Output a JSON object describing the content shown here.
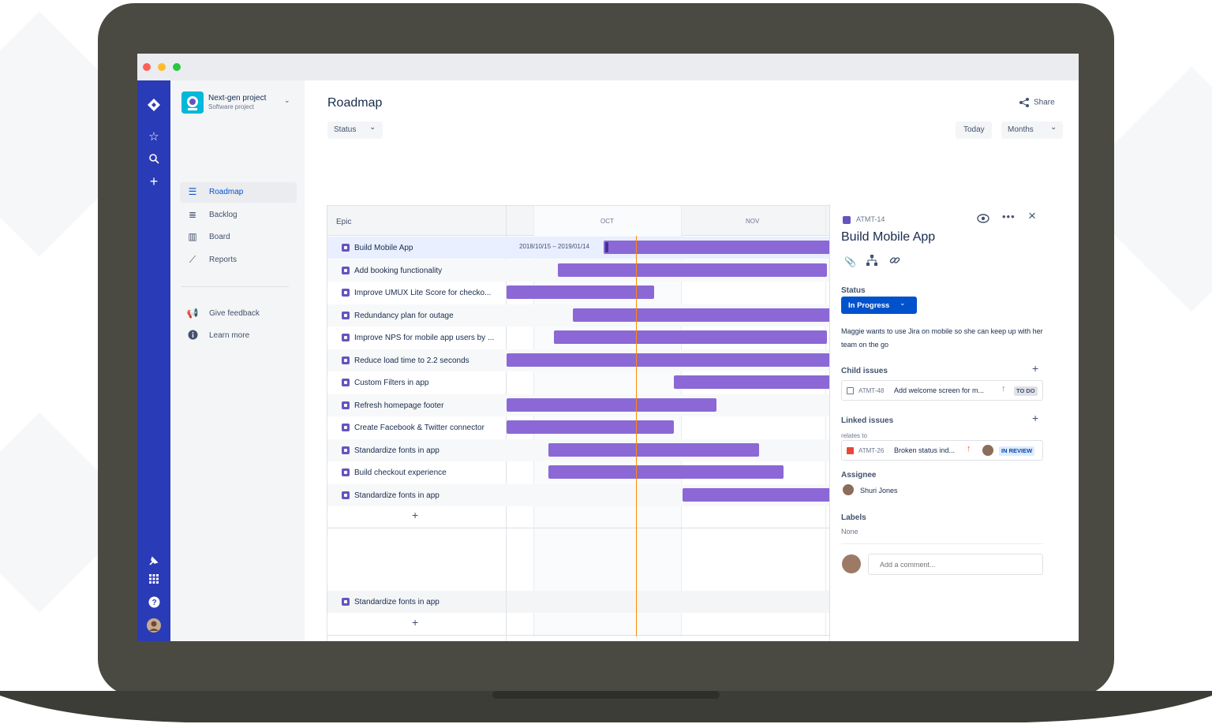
{
  "window": {
    "traffic_lights": [
      "#ff5f57",
      "#febc2e",
      "#28c840"
    ]
  },
  "global_nav": {
    "icons": [
      "jira-logo-icon",
      "star-icon",
      "search-icon",
      "plus-icon",
      "notification-icon",
      "app-switcher-icon",
      "help-icon",
      "user-avatar"
    ]
  },
  "project": {
    "name": "Next-gen project",
    "type": "Software project"
  },
  "sidebar": {
    "items": [
      {
        "label": "Roadmap",
        "icon": "roadmap-icon",
        "active": true
      },
      {
        "label": "Backlog",
        "icon": "backlog-icon",
        "active": false
      },
      {
        "label": "Board",
        "icon": "board-icon",
        "active": false
      },
      {
        "label": "Reports",
        "icon": "reports-icon",
        "active": false
      }
    ],
    "secondary": [
      {
        "label": "Give feedback",
        "icon": "megaphone-icon"
      },
      {
        "label": "Learn more",
        "icon": "info-icon"
      }
    ]
  },
  "header": {
    "title": "Roadmap",
    "share_label": "Share",
    "status_filter": "Status",
    "today_label": "Today",
    "view_select": "Months"
  },
  "timeline": {
    "epic_header": "Epic",
    "months": [
      "OCT",
      "NOV"
    ],
    "first_bar_label": "2018/10/15 – 2019/01/14",
    "epics": [
      {
        "label": "Build Mobile App",
        "selected": true,
        "start": 0.28,
        "end": 1.0
      },
      {
        "label": "Add booking functionality",
        "start": 0.149,
        "end": 0.927
      },
      {
        "label": "Improve UMUX Lite Score for checko...",
        "start": 0.0,
        "end": 0.426
      },
      {
        "label": "Redundancy plan for outage",
        "start": 0.192,
        "end": 1.0
      },
      {
        "label": "Improve NPS for mobile app users by ...",
        "start": 0.137,
        "end": 0.927
      },
      {
        "label": "Reduce load time to 2.2 seconds",
        "start": 0.0,
        "end": 1.0
      },
      {
        "label": "Custom Filters in app",
        "start": 0.483,
        "end": 1.0
      },
      {
        "label": "Refresh homepage footer",
        "start": 0.0,
        "end": 0.608
      },
      {
        "label": "Create Facebook & Twitter connector",
        "start": 0.0,
        "end": 0.483
      },
      {
        "label": "Standardize fonts in app",
        "start": 0.121,
        "end": 0.731
      },
      {
        "label": "Build checkout experience",
        "start": 0.121,
        "end": 0.801
      },
      {
        "label": "Standardize fonts in app",
        "start": 0.51,
        "end": 0.941
      }
    ],
    "extra_epic": "Standardize fonts in app",
    "add_symbol": "+",
    "today_position": 0.374
  },
  "detail": {
    "key": "ATMT-14",
    "title": "Build Mobile App",
    "status_label": "Status",
    "status_value": "In Progress",
    "description": "Maggie wants to use Jira on mobile so she can keep up with her team on the go",
    "child_issues_label": "Child issues",
    "child_issue": {
      "key": "ATMT-48",
      "summary": "Add welcome screen for m...",
      "status": "TO DO"
    },
    "linked_issues_label": "Linked issues",
    "relates_to": "relates to",
    "linked_issue": {
      "key": "ATMT-26",
      "summary": "Broken status ind...",
      "status": "IN REVIEW"
    },
    "assignee_label": "Assignee",
    "assignee": "Shuri Jones",
    "labels_label": "Labels",
    "labels_value": "None",
    "comment_placeholder": "Add a comment..."
  },
  "colors": {
    "nav_blue": "#2a3bb7",
    "epic_purple": "#8b68d6",
    "today_line": "#ff8b00",
    "status_blue": "#0052cc",
    "laptop": "#4a4a43"
  }
}
